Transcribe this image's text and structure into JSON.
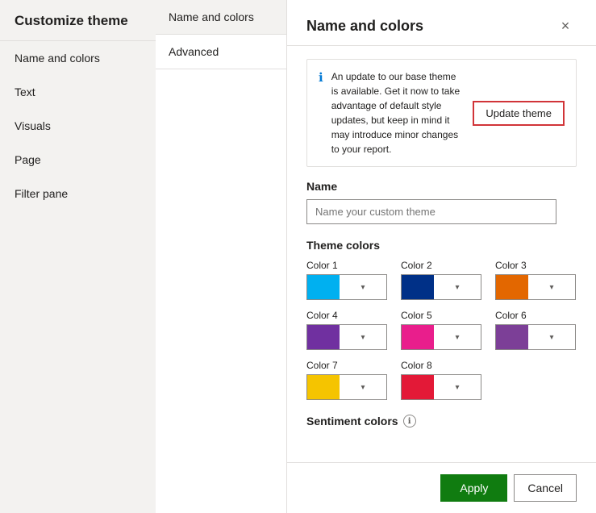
{
  "sidebar": {
    "title": "Customize theme",
    "items": [
      {
        "id": "name-colors",
        "label": "Name and colors"
      },
      {
        "id": "text",
        "label": "Text"
      },
      {
        "id": "visuals",
        "label": "Visuals"
      },
      {
        "id": "page",
        "label": "Page"
      },
      {
        "id": "filter-pane",
        "label": "Filter pane"
      }
    ]
  },
  "center_panel": {
    "items": [
      {
        "id": "name-and-colors",
        "label": "Name and colors",
        "active": true
      },
      {
        "id": "advanced",
        "label": "Advanced",
        "active": false
      }
    ]
  },
  "main": {
    "title": "Name and colors",
    "close_label": "×",
    "info_text": "An update to our base theme is available. Get it now to take advantage of default style updates, but keep in mind it may introduce minor changes to your report.",
    "update_theme_label": "Update theme",
    "name_section": {
      "label": "Name",
      "placeholder": "Name your custom theme"
    },
    "theme_colors_label": "Theme colors",
    "colors": [
      {
        "label": "Color 1",
        "color": "#00b0f0"
      },
      {
        "label": "Color 2",
        "color": "#003087"
      },
      {
        "label": "Color 3",
        "color": "#e36700"
      },
      {
        "label": "Color 4",
        "color": "#7030a0"
      },
      {
        "label": "Color 5",
        "color": "#e91e8c"
      },
      {
        "label": "Color 6",
        "color": "#7c3f97"
      },
      {
        "label": "Color 7",
        "color": "#f5c400"
      },
      {
        "label": "Color 8",
        "color": "#e31937"
      }
    ],
    "sentiment_colors_label": "Sentiment colors",
    "info_icon_label": "ℹ"
  },
  "footer": {
    "apply_label": "Apply",
    "cancel_label": "Cancel"
  }
}
